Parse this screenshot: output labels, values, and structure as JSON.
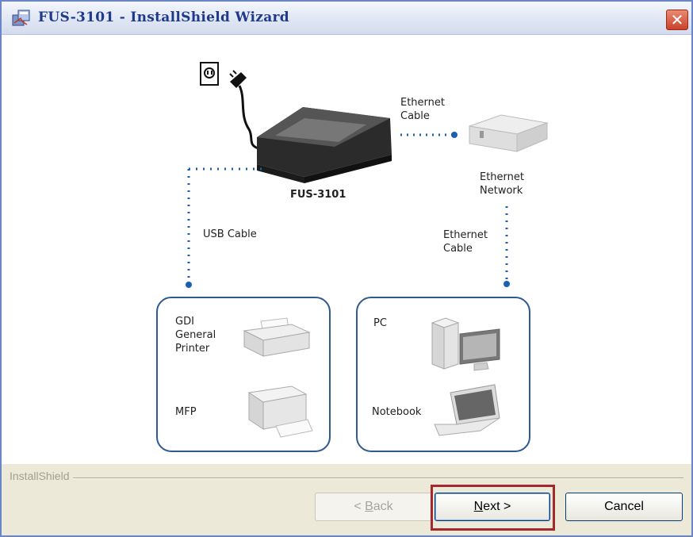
{
  "window": {
    "title": "FUS-3101 - InstallShield Wizard",
    "close_glyph": "✕"
  },
  "diagram": {
    "device_label": "FUS-3101",
    "ethernet_cable_top": "Ethernet\nCable",
    "ethernet_network": "Ethernet\nNetwork",
    "usb_cable": "USB Cable",
    "ethernet_cable_right": "Ethernet\nCable",
    "left_group": {
      "printer_label": "GDI\nGeneral\nPrinter",
      "mfp_label": "MFP"
    },
    "right_group": {
      "pc_label": "PC",
      "notebook_label": "Notebook"
    },
    "colors": {
      "dotted": "#1a5fb4",
      "box_border": "#2f5a8f"
    }
  },
  "footer": {
    "brand": "InstallShield",
    "back": {
      "prefix": "< ",
      "mnemonic": "B",
      "rest": "ack"
    },
    "next": {
      "mnemonic": "N",
      "rest": "ext >"
    },
    "cancel": "Cancel",
    "highlight_color": "#a4282c"
  }
}
